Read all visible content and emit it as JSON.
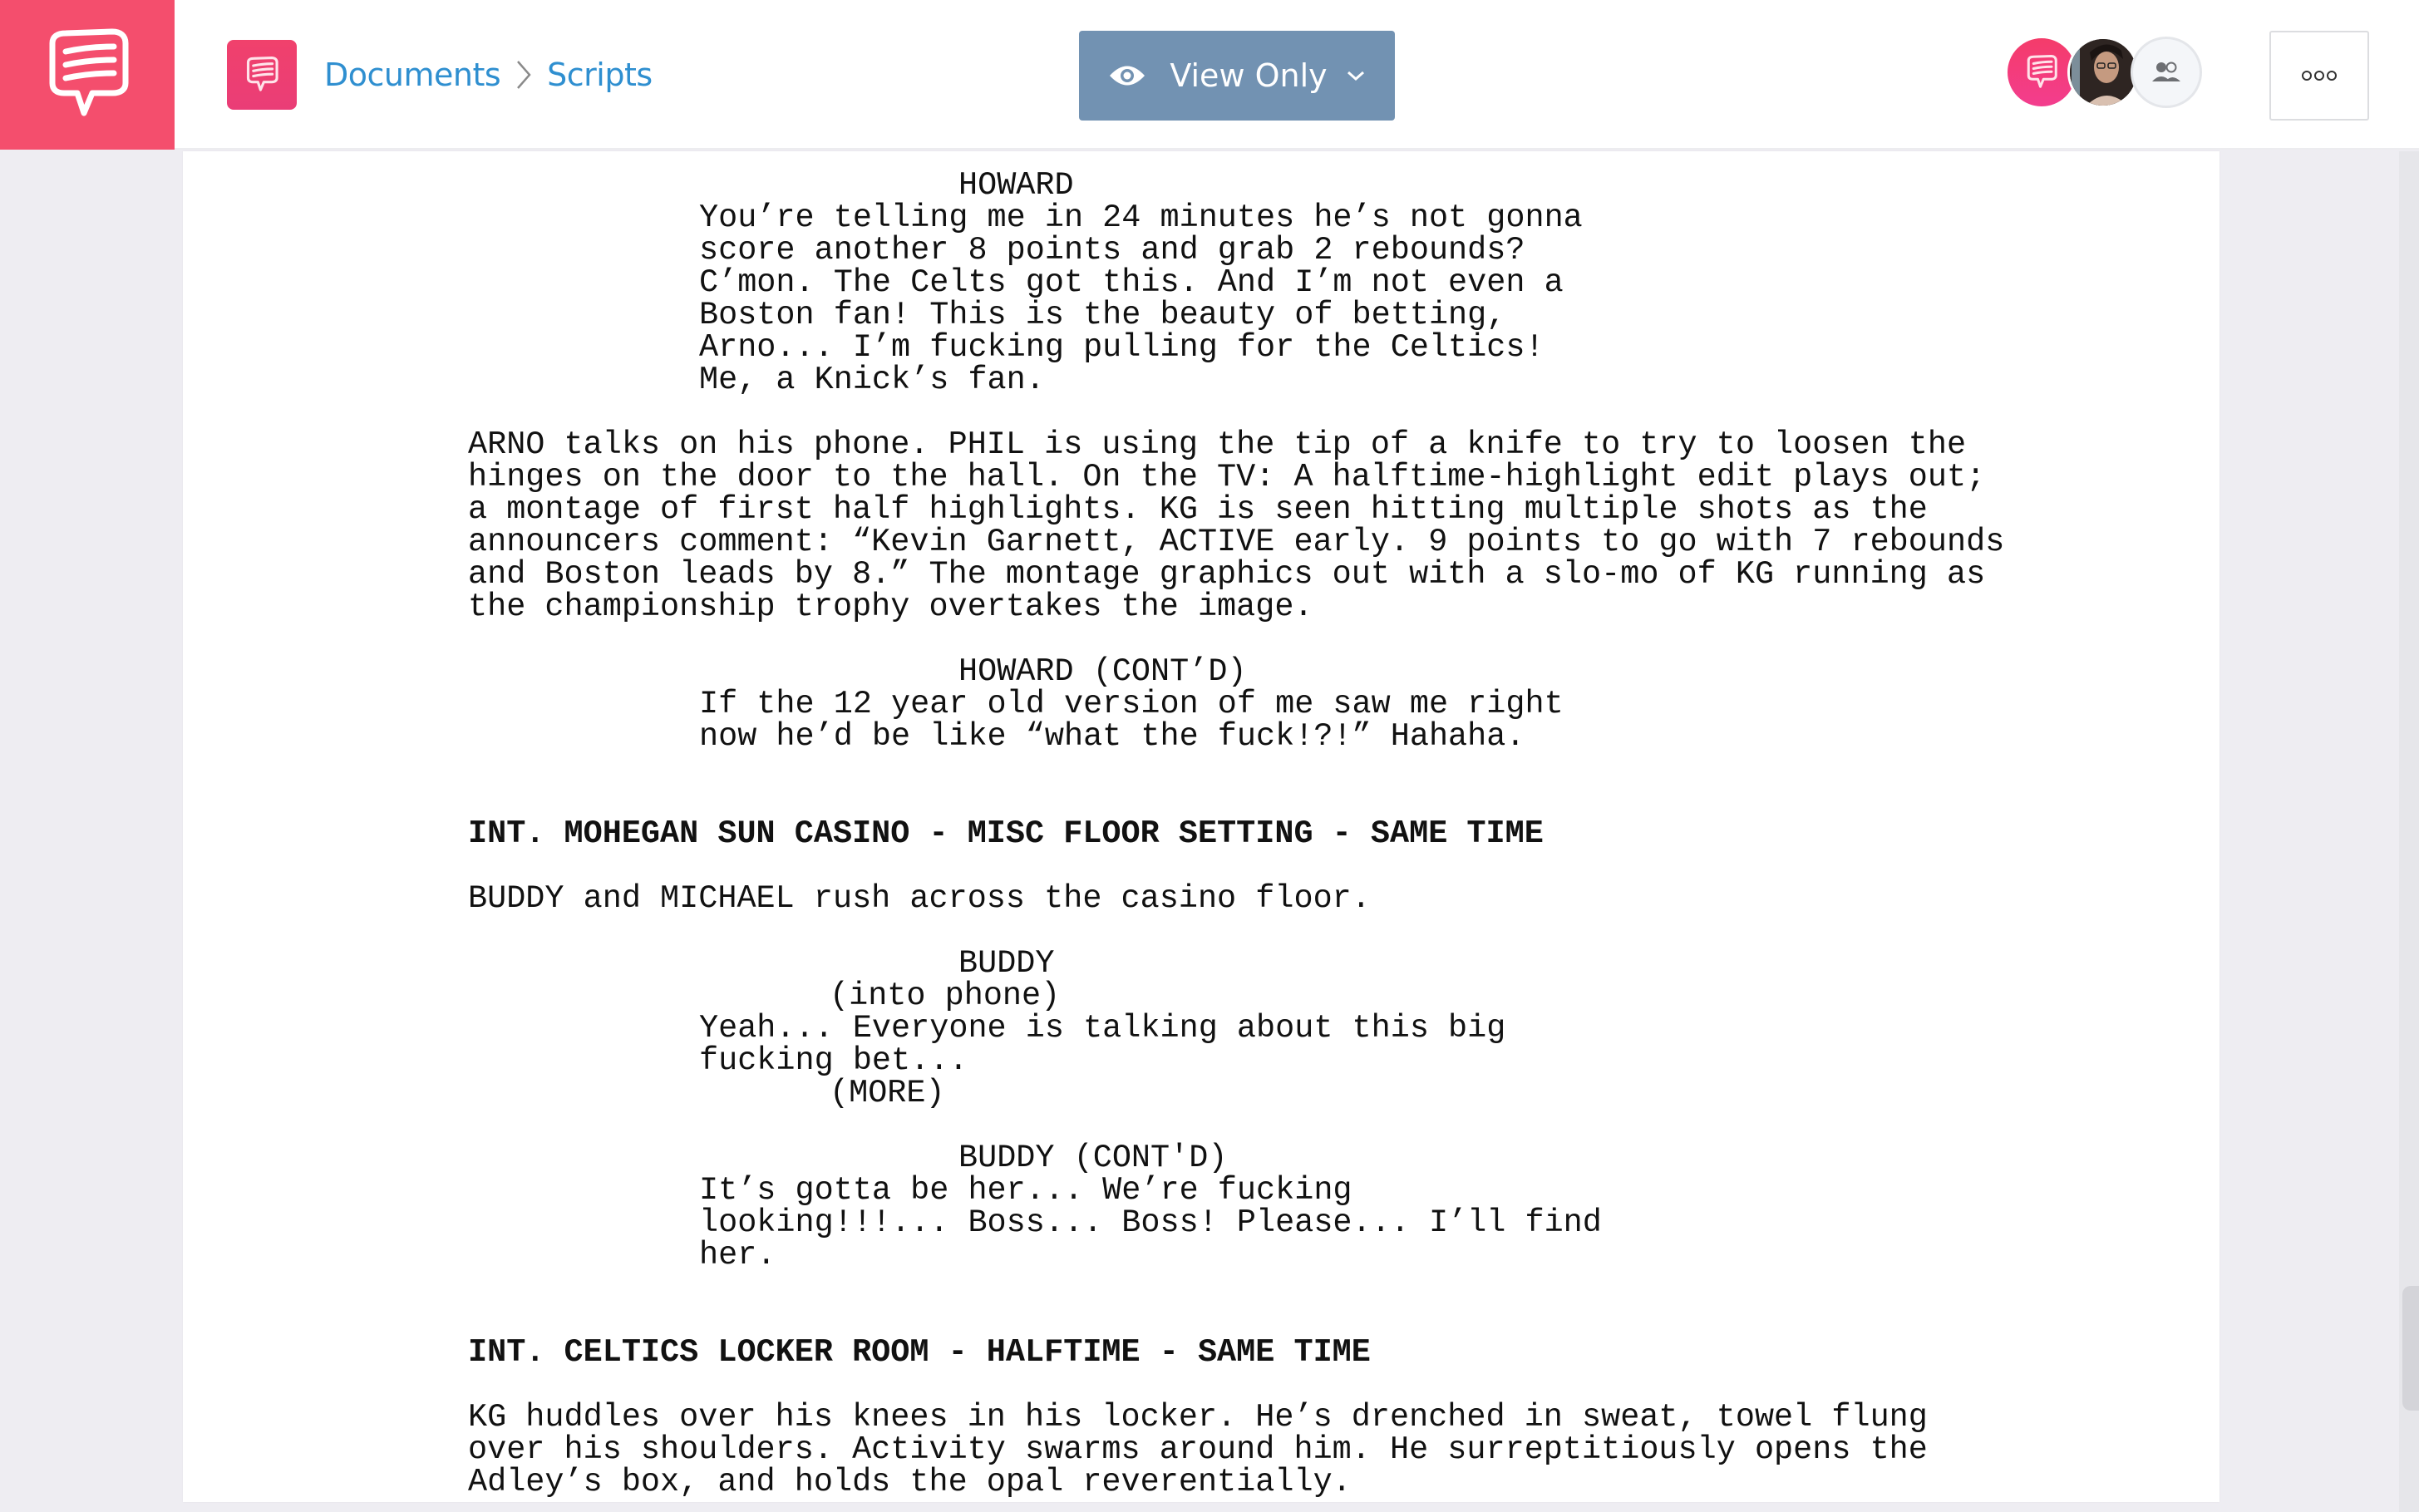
{
  "header": {
    "logo_icon": "chat-bubble-logo-icon",
    "app_icon": "chat-bubble-icon",
    "breadcrumb": [
      {
        "label": "Documents"
      },
      {
        "label": "Scripts"
      }
    ],
    "breadcrumb_separator_icon": "chevron-right-icon",
    "view_mode": {
      "label": "View Only",
      "icon": "eye-icon",
      "dropdown_icon": "chevron-down-icon"
    },
    "collaborators": [
      {
        "type": "brand",
        "icon": "chat-bubble-icon"
      },
      {
        "type": "photo",
        "name": "user-photo"
      },
      {
        "type": "group",
        "icon": "users-icon"
      }
    ],
    "more_icon": "more-options-icon"
  },
  "colors": {
    "brand": "#f44e6d",
    "link": "#2f8fd0",
    "view_button": "#7292b2",
    "background": "#eeedf2"
  },
  "script": {
    "blocks": [
      {
        "type": "character",
        "text": "HOWARD"
      },
      {
        "type": "dialogue",
        "text": "You’re telling me in 24 minutes he’s not gonna"
      },
      {
        "type": "dialogue",
        "text": "score another 8 points and grab 2 rebounds?"
      },
      {
        "type": "dialogue",
        "text": "C’mon. The Celts got this. And I’m not even a"
      },
      {
        "type": "dialogue",
        "text": "Boston fan! This is the beauty of betting,"
      },
      {
        "type": "dialogue",
        "text": "Arno... I’m fucking pulling for the Celtics!"
      },
      {
        "type": "dialogue",
        "text": "Me, a Knick’s fan."
      },
      {
        "type": "gap"
      },
      {
        "type": "action",
        "text": "ARNO talks on his phone. PHIL is using the tip of a knife to try to loosen the"
      },
      {
        "type": "action",
        "text": "hinges on the door to the hall. On the TV: A halftime-highlight edit plays out;"
      },
      {
        "type": "action",
        "text": "a montage of first half highlights. KG is seen hitting multiple shots as the"
      },
      {
        "type": "action",
        "text": "announcers comment: “Kevin Garnett, ACTIVE early. 9 points to go with 7 rebounds"
      },
      {
        "type": "action",
        "text": "and Boston leads by 8.” The montage graphics out with a slo-mo of KG running as"
      },
      {
        "type": "action",
        "text": "the championship trophy overtakes the image."
      },
      {
        "type": "gap"
      },
      {
        "type": "character",
        "text": "HOWARD (CONT’D)"
      },
      {
        "type": "dialogue",
        "text": "If the 12 year old version of me saw me right"
      },
      {
        "type": "dialogue",
        "text": "now he’d be like “what the fuck!?!” Hahaha."
      },
      {
        "type": "gap"
      },
      {
        "type": "gap"
      },
      {
        "type": "slug",
        "text": "INT. MOHEGAN SUN CASINO - MISC FLOOR SETTING - SAME TIME"
      },
      {
        "type": "gap"
      },
      {
        "type": "action",
        "text": "BUDDY and MICHAEL rush across the casino floor."
      },
      {
        "type": "gap"
      },
      {
        "type": "character",
        "text": "BUDDY"
      },
      {
        "type": "paren",
        "text": "(into phone)"
      },
      {
        "type": "dialogue",
        "text": "Yeah... Everyone is talking about this big"
      },
      {
        "type": "dialogue",
        "text": "fucking bet..."
      },
      {
        "type": "paren",
        "text": "(MORE)"
      },
      {
        "type": "gap"
      },
      {
        "type": "character",
        "text": "BUDDY (CONT'D)"
      },
      {
        "type": "dialogue",
        "text": "It’s gotta be her... We’re fucking"
      },
      {
        "type": "dialogue",
        "text": "looking!!!... Boss... Boss! Please... I’ll find"
      },
      {
        "type": "dialogue",
        "text": "her."
      },
      {
        "type": "gap"
      },
      {
        "type": "gap"
      },
      {
        "type": "slug",
        "text": "INT. CELTICS LOCKER ROOM - HALFTIME - SAME TIME"
      },
      {
        "type": "gap"
      },
      {
        "type": "action",
        "text": "KG huddles over his knees in his locker. He’s drenched in sweat, towel flung"
      },
      {
        "type": "action",
        "text": "over his shoulders. Activity swarms around him. He surreptitiously opens the"
      },
      {
        "type": "action",
        "text": "Adley’s box, and holds the opal reverentially."
      }
    ]
  }
}
